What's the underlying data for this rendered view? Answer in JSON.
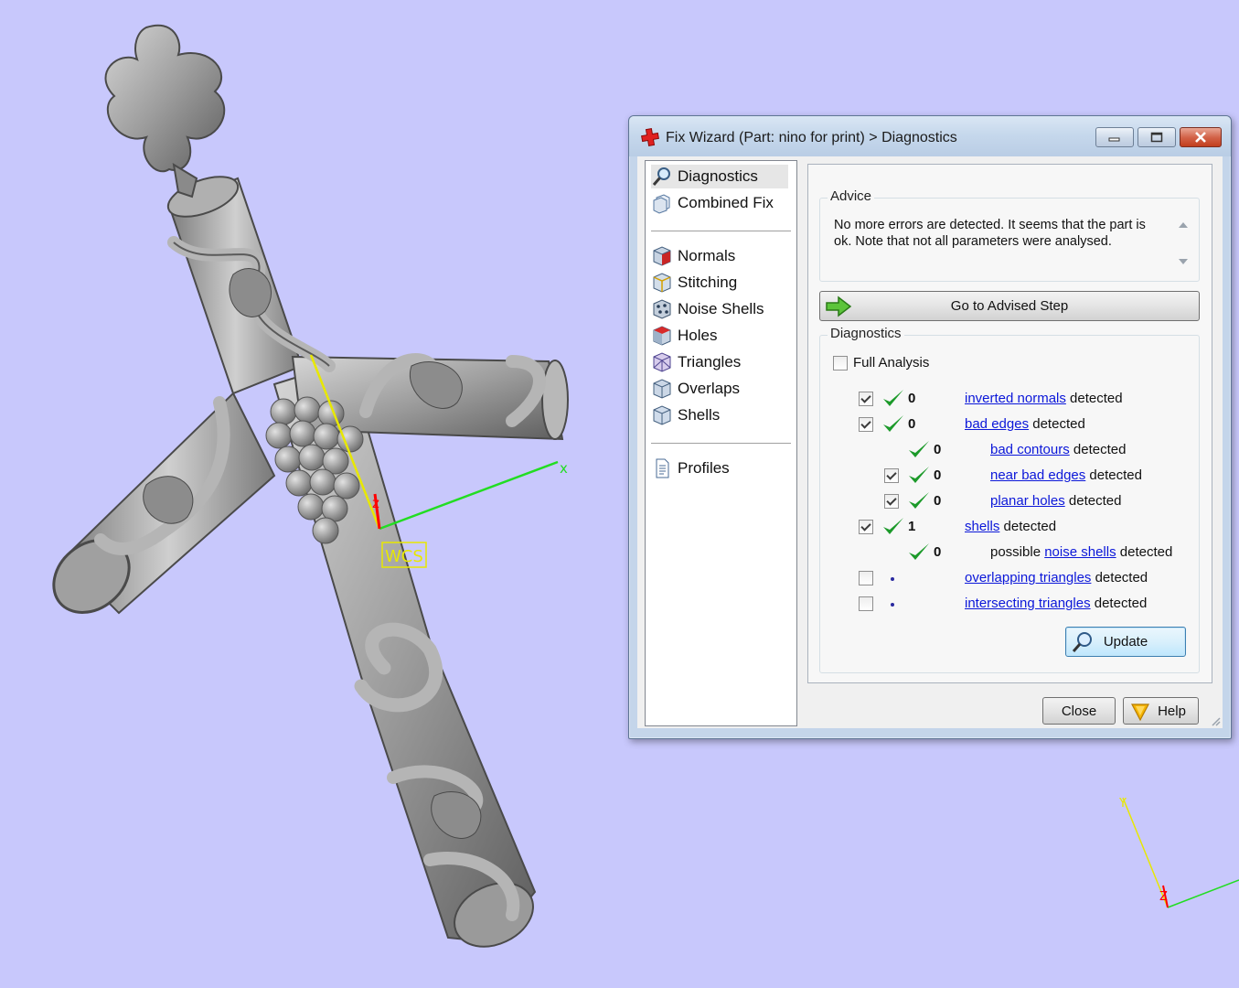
{
  "window": {
    "title": "Fix Wizard (Part: nino for print) > Diagnostics"
  },
  "viewport": {
    "wcs_label": "WCS",
    "axis_x": "x",
    "axis_z": "z",
    "mini_axis_y": "Y",
    "mini_axis_z": "Z",
    "colors": {
      "background": "#c8c8fc",
      "x_axis": "#22dd22",
      "y_axis": "#e8e800",
      "z_axis": "#ff0000"
    }
  },
  "nav": {
    "items": [
      {
        "label": "Diagnostics",
        "icon": "magnifier-icon"
      },
      {
        "label": "Combined Fix",
        "icon": "cube-stack-icon"
      },
      {
        "label": "Normals",
        "icon": "cube-red-face-icon"
      },
      {
        "label": "Stitching",
        "icon": "cube-stitch-icon"
      },
      {
        "label": "Noise Shells",
        "icon": "noise-shells-icon"
      },
      {
        "label": "Holes",
        "icon": "cube-hole-icon"
      },
      {
        "label": "Triangles",
        "icon": "triangle-mesh-icon"
      },
      {
        "label": "Overlaps",
        "icon": "cube-overlap-icon"
      },
      {
        "label": "Shells",
        "icon": "shells-icon"
      },
      {
        "label": "Profiles",
        "icon": "document-icon"
      }
    ]
  },
  "advice": {
    "title": "Advice",
    "text": "No more errors are detected. It seems that the part is ok. Note that not all parameters were analysed."
  },
  "advised_step_button": "Go to Advised Step",
  "diagnostics": {
    "title": "Diagnostics",
    "full_analysis_label": "Full Analysis",
    "rows": [
      {
        "checked": true,
        "status": "ok",
        "count": "0",
        "prefix": "",
        "link": "inverted normals",
        "suffix": " detected"
      },
      {
        "checked": true,
        "status": "ok",
        "count": "0",
        "prefix": "",
        "link": "bad edges",
        "suffix": " detected"
      },
      {
        "checked": null,
        "status": "ok",
        "count": "0",
        "prefix": "",
        "link": "bad contours",
        "suffix": " detected"
      },
      {
        "checked": true,
        "status": "ok",
        "count": "0",
        "prefix": "",
        "link": "near bad edges",
        "suffix": " detected"
      },
      {
        "checked": true,
        "status": "ok",
        "count": "0",
        "prefix": "",
        "link": "planar holes",
        "suffix": " detected"
      },
      {
        "checked": true,
        "status": "ok",
        "count": "1",
        "prefix": "",
        "link": "shells",
        "suffix": " detected"
      },
      {
        "checked": null,
        "status": "ok",
        "count": "0",
        "prefix": "possible ",
        "link": "noise shells",
        "suffix": " detected"
      },
      {
        "checked": false,
        "status": "unknown",
        "count": "",
        "prefix": "",
        "link": "overlapping triangles",
        "suffix": " detected"
      },
      {
        "checked": false,
        "status": "unknown",
        "count": "",
        "prefix": "",
        "link": "intersecting triangles",
        "suffix": " detected"
      }
    ],
    "update_button": "Update"
  },
  "footer": {
    "close_button": "Close",
    "help_button": "Help"
  }
}
